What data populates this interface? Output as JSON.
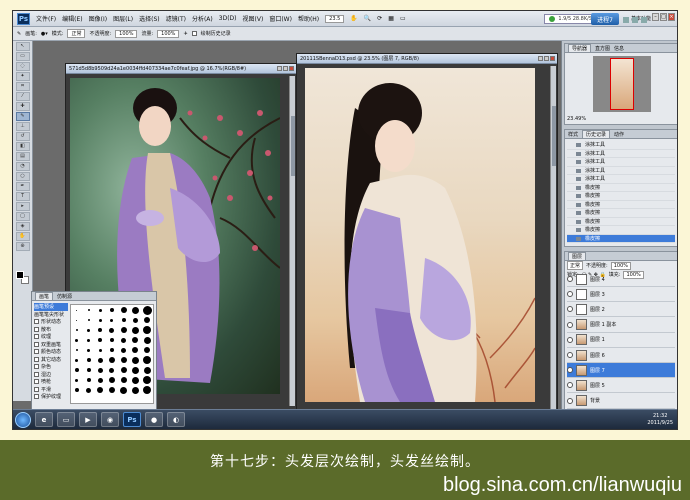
{
  "menubar": {
    "logo": "Ps",
    "items": [
      "文件(F)",
      "编辑(E)",
      "图像(I)",
      "图层(L)",
      "选择(S)",
      "滤镜(T)",
      "分析(A)",
      "3D(D)",
      "视图(V)",
      "窗口(W)",
      "帮助(H)"
    ],
    "zoom": "23.5",
    "status_pill": "1.9/5  28.8K/S",
    "blue_button": "进程7",
    "workspace": "基本功能"
  },
  "optbar": {
    "brush_label": "画笔:",
    "mode_label": "模式:",
    "mode_value": "正常",
    "opacity_label": "不透明度:",
    "opacity_value": "100%",
    "flow_label": "流量:",
    "flow_value": "100%",
    "airbrush_label": "绘制历史记录"
  },
  "doc1": {
    "title": "571d5d8b9509d24a1e0034ffd407334ae7c0feaf.jpg @ 16.7%(RGB/8#)"
  },
  "doc2": {
    "title": "20111SBennaD13.psd @ 23.5% (图层 7, RGB/8)"
  },
  "brushes": {
    "tabs": [
      "画笔",
      "仿制源"
    ],
    "rows": [
      "画笔预设",
      "画笔笔尖形状",
      "形状动态",
      "散布",
      "纹理",
      "双重画笔",
      "颜色动态",
      "其它动态",
      "杂色",
      "湿边",
      "喷枪",
      "平滑",
      "保护纹理"
    ]
  },
  "navigator": {
    "tabs": [
      "导航器",
      "直方图",
      "信息"
    ],
    "zoom": "23.49%"
  },
  "history": {
    "tabs": [
      "样式",
      "历史记录",
      "动作"
    ],
    "items": [
      "涂抹工具",
      "涂抹工具",
      "涂抹工具",
      "涂抹工具",
      "涂抹工具",
      "橡皮擦",
      "橡皮擦",
      "橡皮擦",
      "橡皮擦",
      "橡皮擦",
      "橡皮擦",
      "橡皮擦"
    ]
  },
  "layers": {
    "tab": "图层",
    "mode": "正常",
    "opacity_label": "不透明度:",
    "opacity": "100%",
    "lock_label": "锁定:",
    "fill_label": "填充:",
    "fill": "100%",
    "items": [
      "图层 4",
      "图层 3",
      "图层 2",
      "图层 1 副本",
      "图层 1",
      "图层 6",
      "图层 7",
      "图层 5",
      "背景"
    ],
    "selected_index": 6
  },
  "taskbar": {
    "ps_label": "Ps",
    "time": "21:32",
    "date": "2011/9/25"
  },
  "caption": "第十七步：头发层次绘制，头发丝绘制。",
  "watermark": "blog.sina.com.cn/lianwuqiu"
}
